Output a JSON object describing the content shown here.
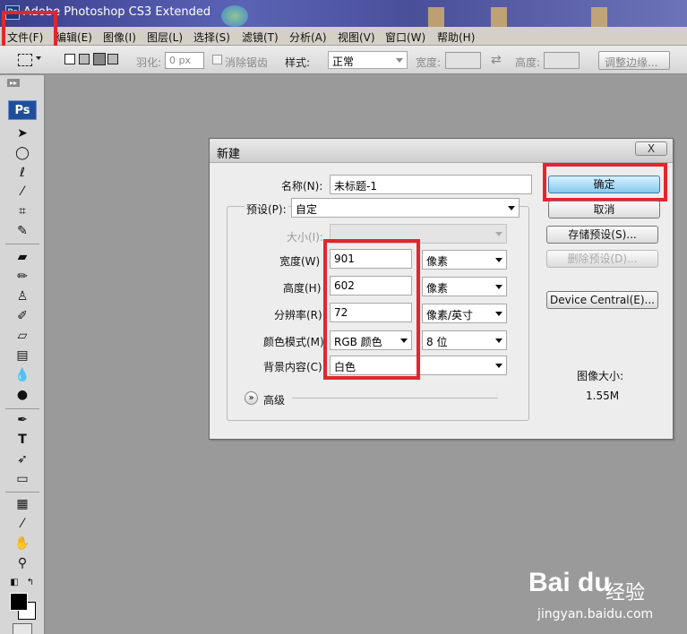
{
  "window": {
    "title": "Adobe Photoshop CS3 Extended",
    "ps_icon": "Ps"
  },
  "menu": [
    "文件(F)",
    "编辑(E)",
    "图像(I)",
    "图层(L)",
    "选择(S)",
    "滤镜(T)",
    "分析(A)",
    "视图(V)",
    "窗口(W)",
    "帮助(H)"
  ],
  "options": {
    "feather_label": "羽化:",
    "feather_value": "0 px",
    "antialias_label": "消除锯齿",
    "style_label": "样式:",
    "style_value": "正常",
    "width_label": "宽度:",
    "height_label": "高度:",
    "refine_button": "调整边缘..."
  },
  "toolbox": {
    "logo": "Ps",
    "icons": [
      "move-tool-icon",
      "elliptical-marquee-icon",
      "lasso-icon",
      "magic-wand-icon",
      "crop-icon",
      "slice-icon",
      "healing-brush-icon",
      "brush-icon",
      "clone-stamp-icon",
      "history-brush-icon",
      "eraser-icon",
      "gradient-icon",
      "blur-icon",
      "dodge-icon",
      "pen-icon",
      "type-icon",
      "path-selection-icon",
      "rectangle-shape-icon",
      "notes-icon",
      "eyedropper-icon",
      "hand-icon",
      "zoom-icon"
    ]
  },
  "dialog": {
    "title": "新建",
    "close": "X",
    "name_label": "名称(N):",
    "name_value": "未标题-1",
    "preset_label": "预设(P):",
    "preset_value": "自定",
    "size_label": "大小(I):",
    "width_label": "宽度(W)",
    "width_value": "901",
    "width_unit": "像素",
    "height_label": "高度(H)",
    "height_value": "602",
    "height_unit": "像素",
    "resolution_label": "分辨率(R)",
    "resolution_value": "72",
    "resolution_unit": "像素/英寸",
    "color_mode_label": "颜色模式(M)",
    "color_mode_value": "RGB 颜色",
    "bit_depth_value": "8 位",
    "background_label": "背景内容(C)",
    "background_value": "白色",
    "advanced_label": "高级",
    "ok_button": "确定",
    "cancel_button": "取消",
    "save_preset_button": "存储预设(S)...",
    "delete_preset_button": "删除预设(D)...",
    "device_central_button": "Device Central(E)...",
    "image_size_label": "图像大小:",
    "image_size_value": "1.55M"
  },
  "watermark": {
    "logo": "Bai du",
    "cn": "经验",
    "url": "jingyan.baidu.com"
  },
  "colors": {
    "highlight": "#e3262c",
    "workspace": "#9a9a9a",
    "primary_button": "#87c9ee"
  }
}
